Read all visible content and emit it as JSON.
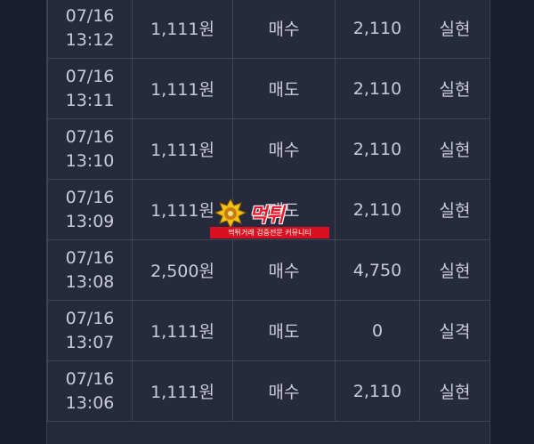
{
  "rows": [
    {
      "date": "07/16",
      "time": "13:12",
      "amount": "1,111원",
      "type": "매수",
      "price": "2,110",
      "result": "실현",
      "status": "win"
    },
    {
      "date": "07/16",
      "time": "13:11",
      "amount": "1,111원",
      "type": "매도",
      "price": "2,110",
      "result": "실현",
      "status": "win"
    },
    {
      "date": "07/16",
      "time": "13:10",
      "amount": "1,111원",
      "type": "매수",
      "price": "2,110",
      "result": "실현",
      "status": "win"
    },
    {
      "date": "07/16",
      "time": "13:09",
      "amount": "1,111원",
      "type": "매도",
      "price": "2,110",
      "result": "실현",
      "status": "win"
    },
    {
      "date": "07/16",
      "time": "13:08",
      "amount": "2,500원",
      "type": "매수",
      "price": "4,750",
      "result": "실현",
      "status": "win"
    },
    {
      "date": "07/16",
      "time": "13:07",
      "amount": "1,111원",
      "type": "매도",
      "price": "0",
      "result": "실격",
      "status": "lose"
    },
    {
      "date": "07/16",
      "time": "13:06",
      "amount": "1,111원",
      "type": "매수",
      "price": "2,110",
      "result": "실현",
      "status": "win"
    }
  ],
  "watermark": {
    "title": "먹튀",
    "subtitle": "먹튀거래 검증전문 커뮤니티"
  },
  "colors": {
    "win": "#3fae5b",
    "lose": "#e1454a",
    "text": "#c9ccd8",
    "panel": "#262a3c"
  }
}
